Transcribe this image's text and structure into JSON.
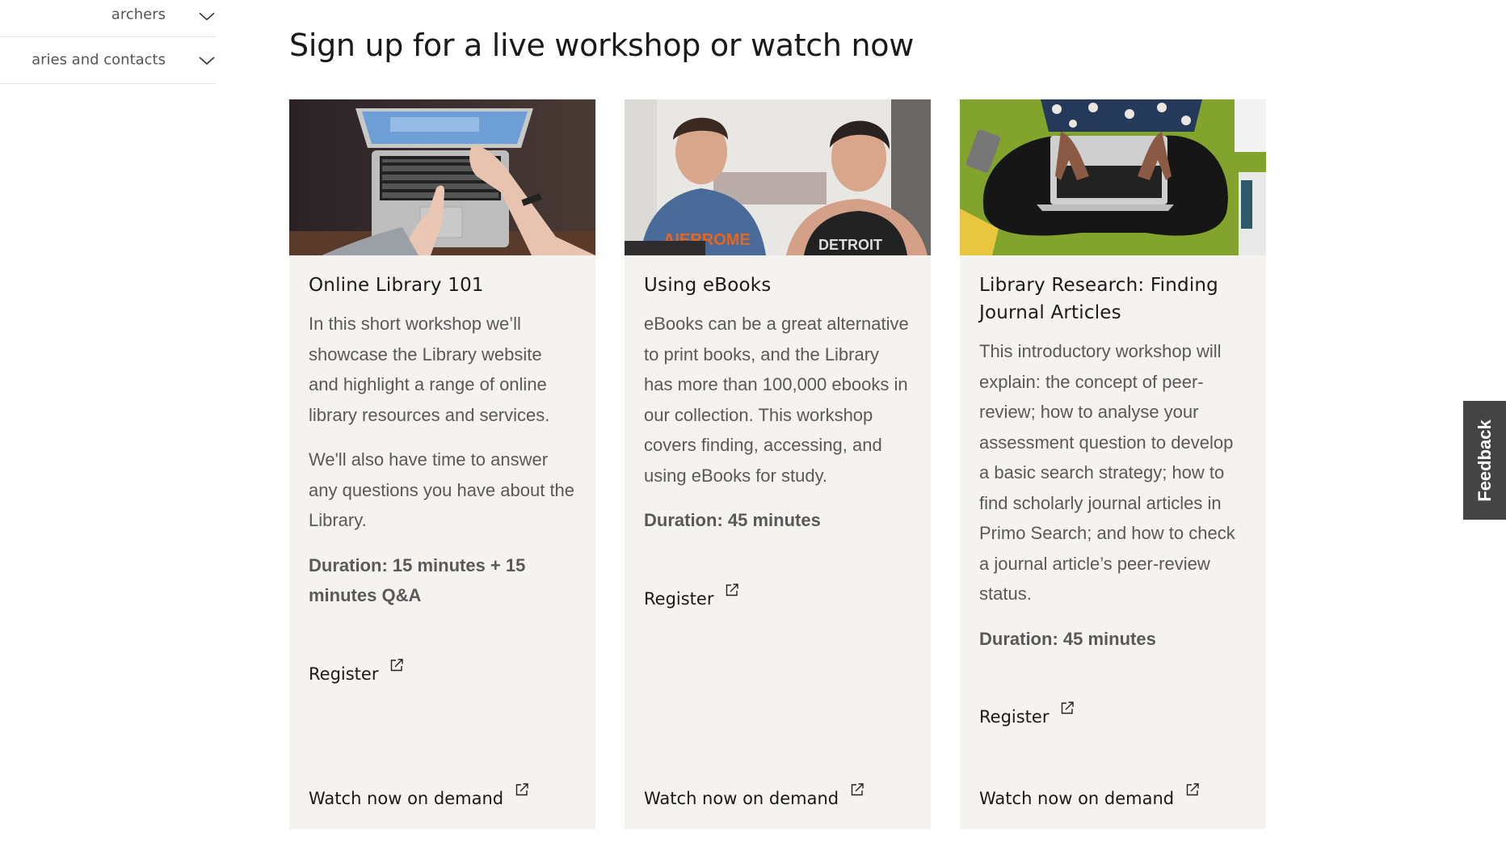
{
  "sidebar": {
    "items": [
      {
        "label": "Information for researchers",
        "visible_label": "archers",
        "icon": "chevron-down-icon"
      },
      {
        "label": "Libraries and contacts",
        "visible_label": "aries and contacts",
        "icon": "chevron-down-icon"
      }
    ]
  },
  "section": {
    "title": "Sign up for a live workshop or watch now"
  },
  "cards": [
    {
      "image": "laptop-hands-photo",
      "title": "Online Library 101",
      "description": [
        "In this short workshop we’ll showcase the Library website and highlight a range of online library resources and services.",
        "We'll also have time to answer any questions you have about the Library."
      ],
      "duration": "Duration: 15 minutes + 15 minutes Q&A",
      "register_label": "Register",
      "watch_label": "Watch now on demand",
      "link_icon": "external-link-icon"
    },
    {
      "image": "two-students-smiling-photo",
      "title": "Using eBooks",
      "description": [
        "eBooks can be a great alternative to print books, and the Library has more than 100,000 ebooks in our collection. This workshop covers finding, accessing, and using eBooks for study."
      ],
      "duration": "Duration: 45 minutes",
      "register_label": "Register",
      "watch_label": "Watch now on demand",
      "link_icon": "external-link-icon"
    },
    {
      "image": "student-laptop-on-grass-photo",
      "title": "Library Research: Finding Journal Articles",
      "description": [
        "This introductory workshop will explain: the concept of peer-review; how to analyse your assessment question to develop a basic search strategy; how to find scholarly journal articles in Primo Search; and how to check a journal article’s peer-review status."
      ],
      "duration": "Duration: 45 minutes",
      "register_label": "Register",
      "watch_label": "Watch now on demand",
      "link_icon": "external-link-icon"
    }
  ],
  "feedback": {
    "label": "Feedback"
  },
  "colors": {
    "card_background": "#f5f3f0",
    "body_text": "#595959",
    "heading_text": "#1a1a1a",
    "feedback_tab": "#444444",
    "divider": "#e6e4e1"
  }
}
